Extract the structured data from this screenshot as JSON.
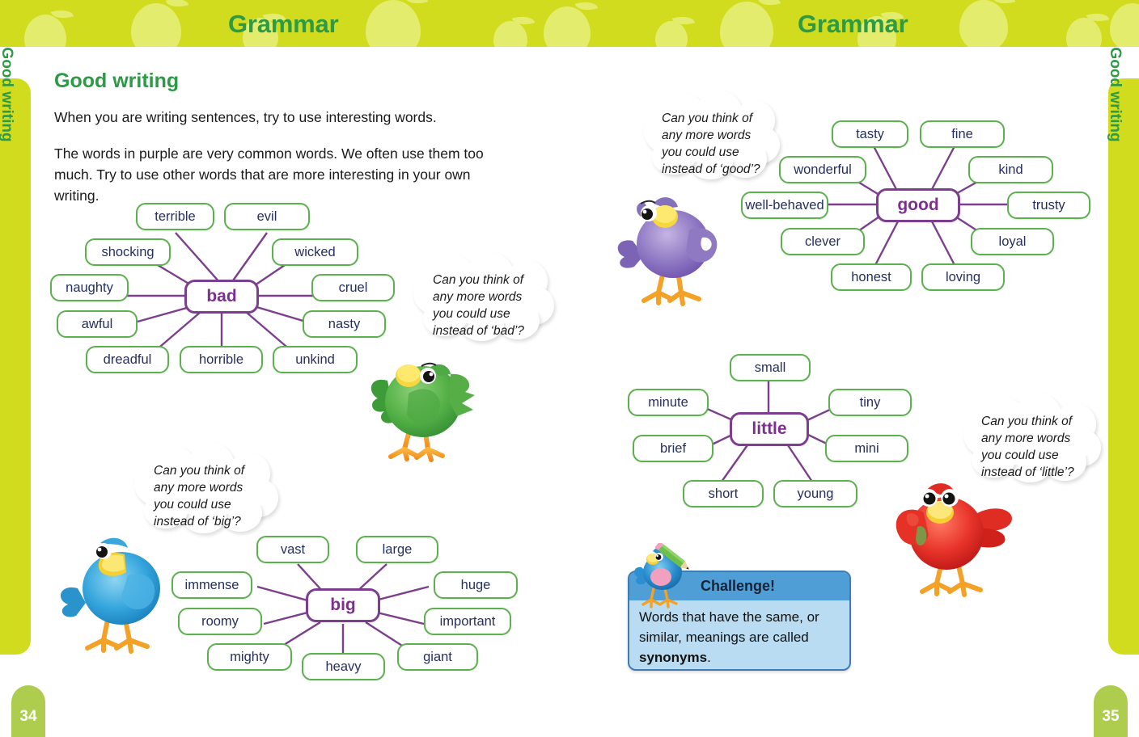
{
  "header": {
    "title_left": "Grammar",
    "title_right": "Grammar",
    "band_color": "#d2dc1e",
    "title_color": "#2d9a46"
  },
  "side_tabs": {
    "left_label": "Good writing",
    "right_label": "Good writing"
  },
  "page_numbers": {
    "left": "34",
    "right": "35"
  },
  "left_page": {
    "heading": "Good writing",
    "paragraph_1": "When you are writing sentences, try to use interesting words.",
    "paragraph_2": "The words in purple are very common words. We often use them too much. Try to use other words that are more interesting in your own writing."
  },
  "colors": {
    "node_border": "#5cb04e",
    "node_text": "#26305e",
    "center_border": "#7c3f8e",
    "center_text": "#7c2f8e",
    "connector": "#7c3f8e",
    "challenge_header": "#4f9ed6",
    "challenge_body": "#b9dcf2"
  },
  "webs": [
    {
      "id": "bad",
      "center": "bad",
      "nodes": [
        "terrible",
        "evil",
        "shocking",
        "wicked",
        "naughty",
        "cruel",
        "awful",
        "nasty",
        "dreadful",
        "horrible",
        "unkind"
      ]
    },
    {
      "id": "big",
      "center": "big",
      "nodes": [
        "vast",
        "large",
        "immense",
        "huge",
        "roomy",
        "important",
        "mighty",
        "heavy",
        "giant"
      ]
    },
    {
      "id": "good",
      "center": "good",
      "nodes": [
        "tasty",
        "fine",
        "wonderful",
        "kind",
        "well-behaved",
        "trusty",
        "clever",
        "loyal",
        "honest",
        "loving"
      ]
    },
    {
      "id": "little",
      "center": "little",
      "nodes": [
        "small",
        "minute",
        "tiny",
        "brief",
        "mini",
        "short",
        "young"
      ]
    }
  ],
  "clouds": {
    "bad": [
      "Can you think of",
      "any more words",
      "you could use",
      "instead of ‘bad’?"
    ],
    "big": [
      "Can you think of",
      "any more words",
      "you could use",
      "instead of ‘big’?"
    ],
    "good": [
      "Can you think of",
      "any more words",
      "you could use",
      "instead of ‘good’?"
    ],
    "little": [
      "Can you think of",
      "any more words",
      "you could use",
      "instead of ‘little’?"
    ]
  },
  "challenge": {
    "title": "Challenge!",
    "line_1": "Words that have the same, or",
    "line_2": "similar, meanings are called",
    "bold_word": "synonyms",
    "period": "."
  },
  "birds": [
    {
      "name": "green-bird",
      "color": "#4aa83c"
    },
    {
      "name": "blue-bird",
      "color": "#37a7dd"
    },
    {
      "name": "purple-bird",
      "color": "#8a74c0"
    },
    {
      "name": "red-bird",
      "color": "#e8342a"
    },
    {
      "name": "challenge-bird",
      "color": "#2b8fd0"
    }
  ]
}
